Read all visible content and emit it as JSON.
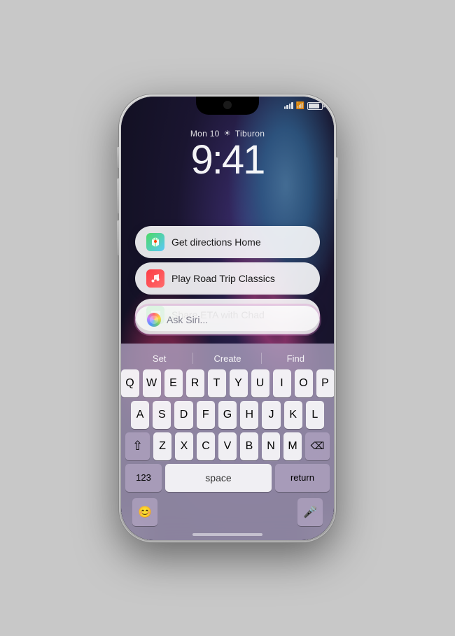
{
  "phone": {
    "status": {
      "date": "Mon 10",
      "location": "Tiburon",
      "time": "9:41"
    },
    "suggestions": [
      {
        "id": "directions",
        "icon_type": "maps",
        "icon_emoji": "🗺",
        "text": "Get directions Home"
      },
      {
        "id": "music",
        "icon_type": "music",
        "icon_emoji": "🎵",
        "text": "Play Road Trip Classics"
      },
      {
        "id": "messages",
        "icon_type": "messages",
        "icon_emoji": "💬",
        "text": "Share ETA with Chad"
      }
    ],
    "siri_input": {
      "placeholder": "Ask Siri..."
    },
    "keyboard": {
      "predictive": [
        "Set",
        "Create",
        "Find"
      ],
      "rows": [
        [
          "Q",
          "W",
          "E",
          "R",
          "T",
          "Y",
          "U",
          "I",
          "O",
          "P"
        ],
        [
          "A",
          "S",
          "D",
          "F",
          "G",
          "H",
          "J",
          "K",
          "L"
        ],
        [
          "Z",
          "X",
          "C",
          "V",
          "B",
          "N",
          "M"
        ],
        [
          "123",
          "space",
          "return"
        ]
      ],
      "bottom": {
        "emoji_label": "😊",
        "mic_label": "🎤",
        "space_label": "space",
        "numbers_label": "123",
        "return_label": "return"
      }
    }
  }
}
